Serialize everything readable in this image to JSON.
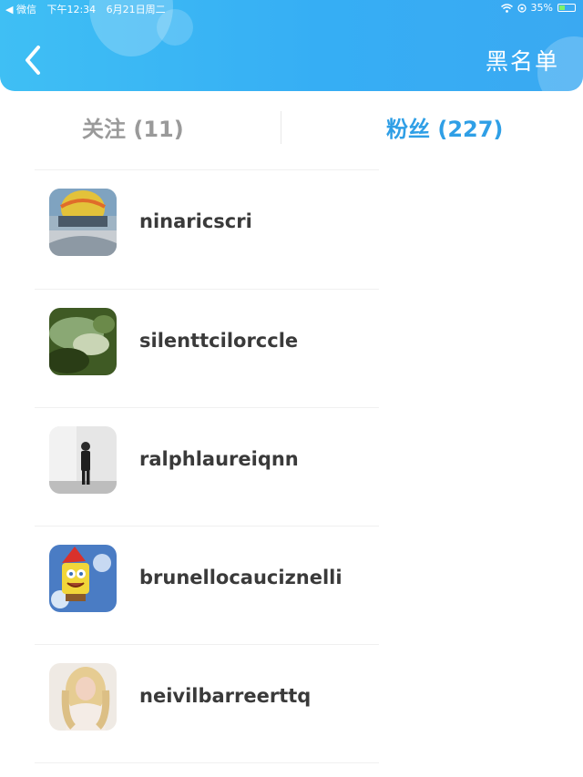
{
  "status_bar": {
    "app": "◀ 微信",
    "time": "下午12:34",
    "date": "6月21日周二",
    "battery": "35%",
    "battery_level": 0.35
  },
  "header": {
    "back_icon": "chevron-left",
    "right_title": "黑名单"
  },
  "tabs": [
    {
      "label": "关注 (11)",
      "active": false
    },
    {
      "label": "粉丝 (227)",
      "active": true
    }
  ],
  "fans": [
    {
      "name": "ninaricscri"
    },
    {
      "name": "silenttcilorccle"
    },
    {
      "name": "ralphlaureiqnn"
    },
    {
      "name": "brunellocauciznelli"
    },
    {
      "name": "neivilbarreerttq"
    }
  ],
  "colors": {
    "header": "#36aef4",
    "active_tab": "#2f9fe6",
    "inactive_tab": "#9a9a9a",
    "username": "#3a3a3a"
  }
}
